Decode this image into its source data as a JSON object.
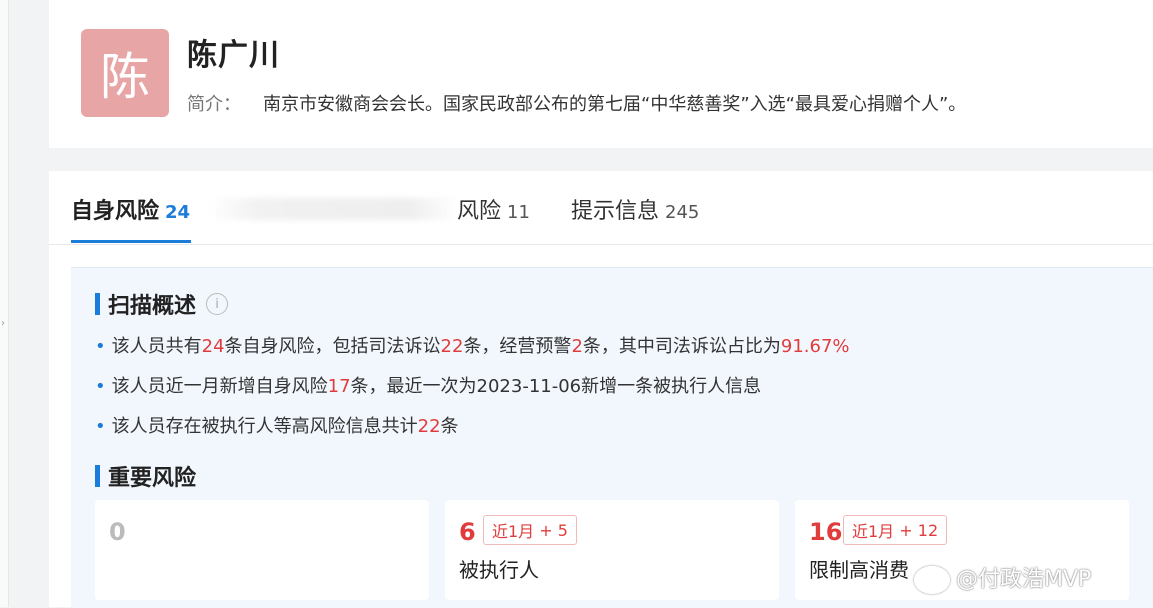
{
  "profile": {
    "avatar_char": "陈",
    "name": "陈广川",
    "intro_label": "简介：",
    "intro_text": "南京市安徽商会会长。国家民政部公布的第七届“中华慈善奖”入选“最具爱心捐赠个人”。"
  },
  "tabs": [
    {
      "label": "自身风险",
      "count": "24",
      "active": true
    },
    {
      "label": "风险",
      "count": "11",
      "active": false
    },
    {
      "label": "提示信息",
      "count": "245",
      "active": false
    }
  ],
  "scan": {
    "title": "扫描概述",
    "info_icon": "i",
    "lines": [
      {
        "parts": [
          {
            "text": "该人员共有"
          },
          {
            "text": "24",
            "red": true
          },
          {
            "text": "条自身风险，包括司法诉讼"
          },
          {
            "text": "22",
            "red": true
          },
          {
            "text": "条，经营预警"
          },
          {
            "text": "2",
            "red": true
          },
          {
            "text": "条，其中司法诉讼占比为"
          },
          {
            "text": "91.67%",
            "red": true
          }
        ]
      },
      {
        "parts": [
          {
            "text": "该人员近一月新增自身风险"
          },
          {
            "text": "17",
            "red": true
          },
          {
            "text": "条，最近一次为2023-11-06新增一条被执行人信息"
          }
        ]
      },
      {
        "parts": [
          {
            "text": "该人员存在被执行人等高风险信息共计"
          },
          {
            "text": "22",
            "red": true
          },
          {
            "text": "条"
          }
        ]
      }
    ]
  },
  "important": {
    "title": "重要风险",
    "cards": [
      {
        "count": "0",
        "badge_prefix": "",
        "badge_value": "",
        "label": ""
      },
      {
        "count": "6",
        "badge_prefix": "近1月",
        "badge_value": "+ 5",
        "label": "被执行人"
      },
      {
        "count": "16",
        "badge_prefix": "近1月",
        "badge_value": "+ 12",
        "label": "限制高消费"
      }
    ]
  },
  "watermark": "@付政浩MVP",
  "colors": {
    "accent": "#1a7dd9",
    "risk_red": "#e03c3c",
    "avatar_bg": "#e8a5a6"
  }
}
